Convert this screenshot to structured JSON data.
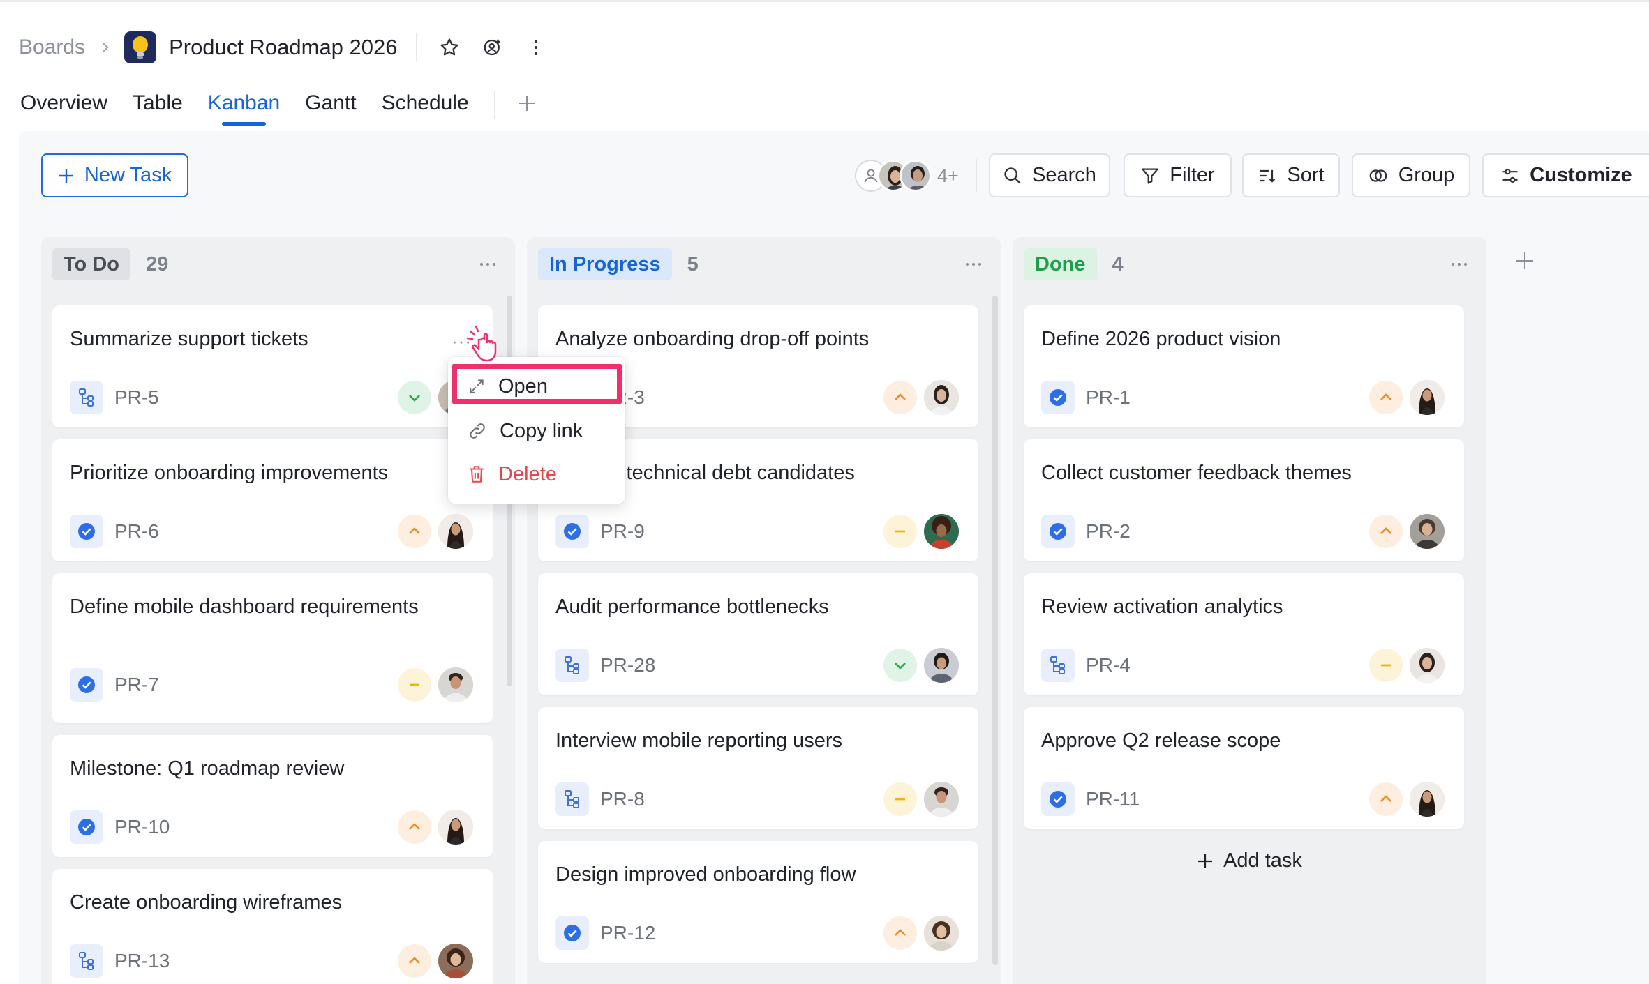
{
  "header": {
    "breadcrumb": "Boards",
    "board_title": "Product Roadmap 2026"
  },
  "tabs": [
    "Overview",
    "Table",
    "Kanban",
    "Gantt",
    "Schedule"
  ],
  "active_tab": "Kanban",
  "toolbar": {
    "new_task": "New Task",
    "members_more": "4+",
    "search": "Search",
    "filter": "Filter",
    "sort": "Sort",
    "group": "Group",
    "customize": "Customize"
  },
  "columns": [
    {
      "name": "To Do",
      "count": "29",
      "cards": [
        {
          "title": "Summarize support tickets",
          "id": "PR-5",
          "type": "subtask",
          "priority": "low"
        },
        {
          "title": "Prioritize onboarding improvements",
          "id": "PR-6",
          "type": "task",
          "priority": "high"
        },
        {
          "title": "Define mobile dashboard requirements",
          "id": "PR-7",
          "type": "task",
          "priority": "medium"
        },
        {
          "title": "Milestone: Q1 roadmap review",
          "id": "PR-10",
          "type": "task",
          "priority": "high"
        },
        {
          "title": "Create onboarding wireframes",
          "id": "PR-13",
          "type": "subtask",
          "priority": "high"
        }
      ]
    },
    {
      "name": "In Progress",
      "count": "5",
      "cards": [
        {
          "title": "Analyze onboarding drop-off points",
          "id": "PR-3",
          "type": "subtask",
          "priority": "high"
        },
        {
          "title": "Identify technical debt candidates",
          "id": "PR-9",
          "type": "task",
          "priority": "medium"
        },
        {
          "title": "Audit performance bottlenecks",
          "id": "PR-28",
          "type": "subtask",
          "priority": "low"
        },
        {
          "title": "Interview mobile reporting users",
          "id": "PR-8",
          "type": "subtask",
          "priority": "medium"
        },
        {
          "title": "Design improved onboarding flow",
          "id": "PR-12",
          "type": "task",
          "priority": "high"
        }
      ]
    },
    {
      "name": "Done",
      "count": "4",
      "add_task": "Add task",
      "cards": [
        {
          "title": "Define 2026 product vision",
          "id": "PR-1",
          "type": "task",
          "priority": "high"
        },
        {
          "title": "Collect customer feedback themes",
          "id": "PR-2",
          "type": "task",
          "priority": "high"
        },
        {
          "title": "Review activation analytics",
          "id": "PR-4",
          "type": "subtask",
          "priority": "medium"
        },
        {
          "title": "Approve Q2 release scope",
          "id": "PR-11",
          "type": "task",
          "priority": "high"
        }
      ]
    }
  ],
  "context_menu": {
    "open": "Open",
    "copy_link": "Copy link",
    "delete": "Delete"
  },
  "colors": {
    "accent": "#1565d8",
    "highlight": "#f0306b",
    "danger": "#e5484d",
    "priority_high": "#f08a24",
    "priority_low": "#28a745",
    "priority_medium": "#f0b400"
  }
}
